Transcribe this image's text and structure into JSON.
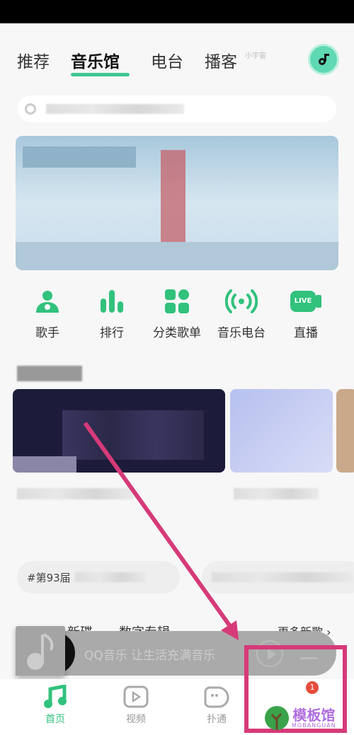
{
  "tabs": [
    {
      "label": "推荐"
    },
    {
      "label": "音乐馆",
      "active": true
    },
    {
      "label": "电台"
    },
    {
      "label": "播客"
    }
  ],
  "podcast_hint": "小宇宙",
  "quick_entries": [
    {
      "label": "歌手",
      "icon": "singer-icon"
    },
    {
      "label": "排行",
      "icon": "chart-icon"
    },
    {
      "label": "分类歌单",
      "icon": "grid-icon"
    },
    {
      "label": "音乐电台",
      "icon": "radio-icon"
    },
    {
      "label": "直播",
      "icon": "live-icon",
      "icon_text": "LIVE"
    }
  ],
  "chips": [
    {
      "label": "#第93届"
    }
  ],
  "new_songs": {
    "tabs": [
      "新碟",
      "数字专辑"
    ],
    "more": "更多新歌"
  },
  "player": {
    "text": "QQ音乐 让生活充满音乐"
  },
  "bottom_nav": [
    {
      "label": "首页",
      "active": true
    },
    {
      "label": "视频"
    },
    {
      "label": "扑通"
    },
    {
      "label": "",
      "badge": "1"
    }
  ],
  "watermark": {
    "cn": "模板馆",
    "en": "MOBANGUAN"
  },
  "colors": {
    "accent": "#31c27c",
    "annotation": "#d63a79"
  }
}
